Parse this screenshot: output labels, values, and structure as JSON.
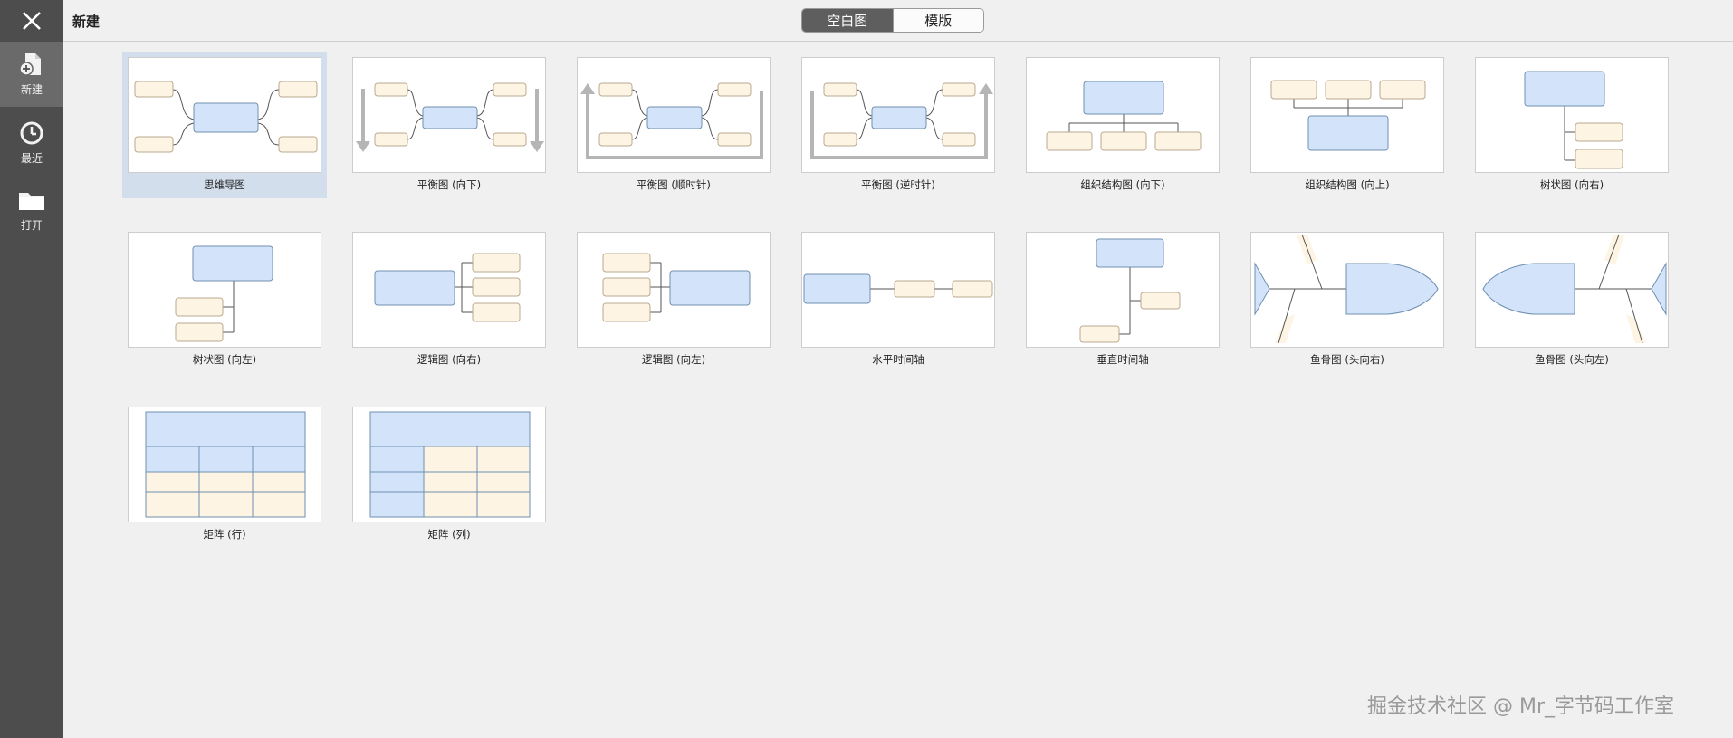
{
  "header": {
    "title": "新建",
    "segment": {
      "blank_label": "空白图",
      "template_label": "模版",
      "selected": "空白图"
    }
  },
  "sidebar": {
    "close_icon": "close-icon",
    "items": [
      {
        "label": "新建",
        "icon": "new-document-icon",
        "active": true
      },
      {
        "label": "最近",
        "icon": "clock-icon",
        "active": false
      },
      {
        "label": "打开",
        "icon": "folder-icon",
        "active": false
      }
    ]
  },
  "templates": [
    {
      "label": "思维导图",
      "selected": true
    },
    {
      "label": "平衡图 (向下)"
    },
    {
      "label": "平衡图 (顺时针)"
    },
    {
      "label": "平衡图 (逆时针)"
    },
    {
      "label": "组织结构图 (向下)"
    },
    {
      "label": "组织结构图 (向上)"
    },
    {
      "label": "树状图 (向右)"
    },
    {
      "label": "树状图 (向左)"
    },
    {
      "label": "逻辑图 (向右)"
    },
    {
      "label": "逻辑图 (向左)"
    },
    {
      "label": "水平时间轴"
    },
    {
      "label": "垂直时间轴"
    },
    {
      "label": "鱼骨图 (头向右)"
    },
    {
      "label": "鱼骨图 (头向左)"
    },
    {
      "label": "矩阵 (行)"
    },
    {
      "label": "矩阵 (列)"
    }
  ],
  "watermark": "掘金技术社区 @ Mr_字节码工作室",
  "colors": {
    "sidebar_bg": "#4d4d4d",
    "main_node": "#d3e4fa",
    "main_node_border": "#6f8fb0",
    "sub_node": "#fdf4e4",
    "sub_node_border": "#b9a98f",
    "selection": "#d2deec"
  }
}
